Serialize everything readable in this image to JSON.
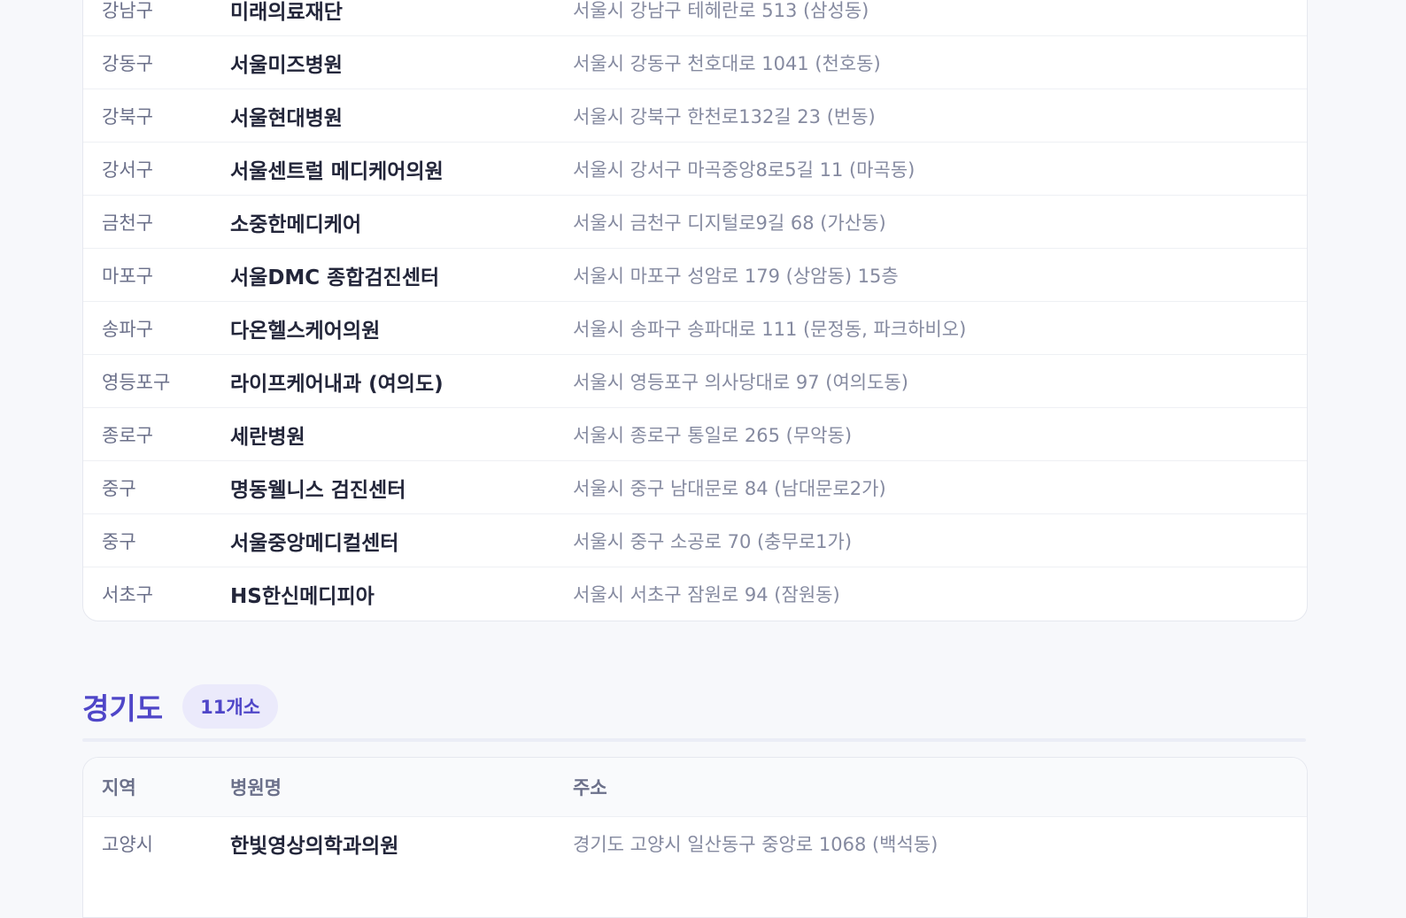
{
  "seoul": {
    "rows": [
      {
        "region": "강남구",
        "name": "미래의료재단",
        "address": "서울시 강남구 테헤란로 513 (삼성동)"
      },
      {
        "region": "강동구",
        "name": "서울미즈병원",
        "address": "서울시 강동구 천호대로 1041 (천호동)"
      },
      {
        "region": "강북구",
        "name": "서울현대병원",
        "address": "서울시 강북구 한천로132길 23 (번동)"
      },
      {
        "region": "강서구",
        "name": "서울센트럴 메디케어의원",
        "address": "서울시 강서구 마곡중앙8로5길 11 (마곡동)"
      },
      {
        "region": "금천구",
        "name": "소중한메디케어",
        "address": "서울시 금천구 디지털로9길 68 (가산동)"
      },
      {
        "region": "마포구",
        "name": "서울DMC 종합검진센터",
        "address": "서울시 마포구 성암로 179 (상암동) 15층"
      },
      {
        "region": "송파구",
        "name": "다온헬스케어의원",
        "address": "서울시 송파구 송파대로 111 (문정동, 파크하비오)"
      },
      {
        "region": "영등포구",
        "name": "라이프케어내과 (여의도)",
        "address": "서울시 영등포구 의사당대로 97 (여의도동)"
      },
      {
        "region": "종로구",
        "name": "세란병원",
        "address": "서울시 종로구 통일로 265 (무악동)"
      },
      {
        "region": "중구",
        "name": "명동웰니스 검진센터",
        "address": "서울시 중구 남대문로 84 (남대문로2가)"
      },
      {
        "region": "중구",
        "name": "서울중앙메디컬센터",
        "address": "서울시 중구 소공로 70 (충무로1가)"
      },
      {
        "region": "서초구",
        "name": "HS한신메디피아",
        "address": "서울시 서초구 잠원로 94 (잠원동)"
      }
    ]
  },
  "gyeonggi": {
    "title": "경기도",
    "count_badge": "11개소",
    "headers": {
      "region": "지역",
      "name": "병원명",
      "address": "주소"
    },
    "rows": [
      {
        "region": "고양시",
        "name": "한빛영상의학과의원",
        "address": "경기도 고양시 일산동구 중앙로 1068 (백석동)"
      }
    ]
  },
  "colors": {
    "accent": "#4f46c8",
    "badge_bg": "#ebeafb",
    "page_bg": "#f7f8fb"
  }
}
